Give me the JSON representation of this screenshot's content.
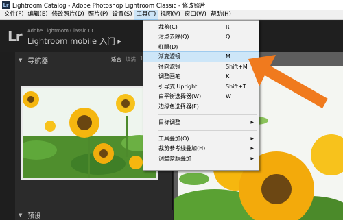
{
  "window": {
    "icon_text": "Lr",
    "title": "Lightroom Catalog - Adobe Photoshop Lightroom Classic - 修改照片"
  },
  "menubar": {
    "items": [
      {
        "label": "文件(F)",
        "active": false
      },
      {
        "label": "编辑(E)",
        "active": false
      },
      {
        "label": "修改照片(D)",
        "active": false
      },
      {
        "label": "照片(P)",
        "active": false
      },
      {
        "label": "设置(S)",
        "active": false
      },
      {
        "label": "工具(T)",
        "active": true
      },
      {
        "label": "视图(V)",
        "active": false
      },
      {
        "label": "窗口(W)",
        "active": false
      },
      {
        "label": "帮助(H)",
        "active": false
      }
    ]
  },
  "identity": {
    "logo": "Lr",
    "line1": "Adobe Lightroom Classic CC",
    "line2": "Lightroom mobile 入门 ▸"
  },
  "navigator": {
    "title": "导航器",
    "zoom_options": [
      "适合",
      "填满",
      "1:1"
    ],
    "selected_zoom": "适合"
  },
  "presets_panel": {
    "title": "预设"
  },
  "tools_menu": {
    "items": [
      {
        "label": "裁剪(C)",
        "shortcut": "R"
      },
      {
        "label": "污点去除(Q)",
        "shortcut": "Q"
      },
      {
        "label": "红眼(D)",
        "shortcut": ""
      },
      {
        "label": "渐变滤镜",
        "shortcut": "M",
        "highlighted": true
      },
      {
        "label": "径向滤镜",
        "shortcut": "Shift+M"
      },
      {
        "label": "调整画笔",
        "shortcut": "K"
      },
      {
        "label": "引导式 Upright",
        "shortcut": "Shift+T"
      },
      {
        "label": "白平衡选择器(W)",
        "shortcut": "W"
      },
      {
        "label": "边缘色选择器(F)",
        "shortcut": ""
      },
      {
        "separator": true
      },
      {
        "label": "目标调整",
        "submenu": true
      },
      {
        "separator": true
      },
      {
        "label": "工具叠加(O)",
        "submenu": true
      },
      {
        "label": "裁剪参考线叠加(H)",
        "submenu": true
      },
      {
        "label": "调整蒙版叠加",
        "submenu": true
      }
    ]
  },
  "colors": {
    "accent_arrow": "#f07a1e",
    "menu_highlight": "#cde6f8"
  }
}
